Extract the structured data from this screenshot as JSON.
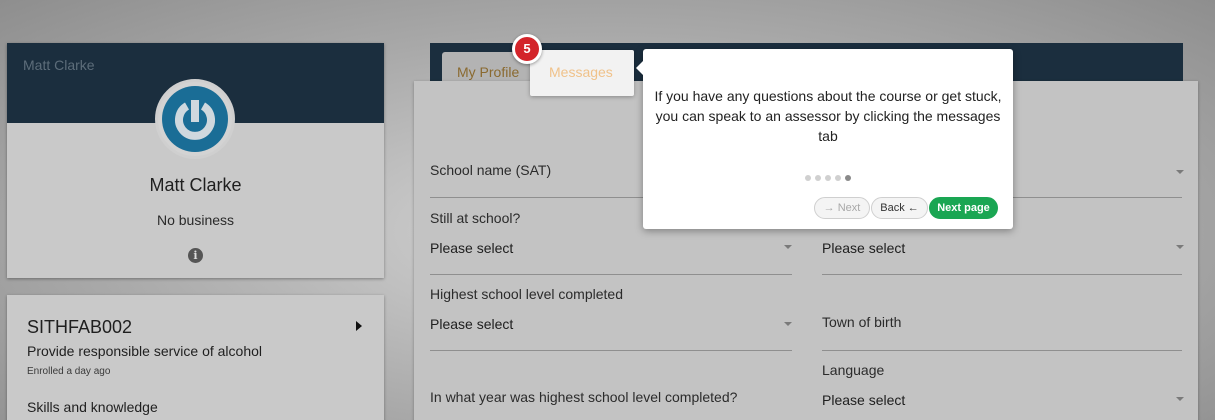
{
  "profile": {
    "header_name": "Matt Clarke",
    "name": "Matt Clarke",
    "business": "No business",
    "info_icon": "i"
  },
  "course": {
    "code": "SITHFAB002",
    "title": "Provide responsible service of alcohol",
    "enrolled": "Enrolled a day ago",
    "section": "Skills and knowledge"
  },
  "tabs": {
    "my_profile": "My Profile",
    "messages": "Messages"
  },
  "tour": {
    "step": "5",
    "text": "If you have any questions about the course or get stuck, you can speak to an assessor by clicking the messages tab",
    "total_steps": 5,
    "current_step": 5,
    "next_label": "→ Next",
    "back_label": "Back ←",
    "next_page_label": "Next page"
  },
  "form": {
    "school_name_label": "School name (SAT)",
    "still_at_school_label": "Still at school?",
    "still_at_school_value": "Please select",
    "right_select_value": "Please select",
    "highest_level_label": "Highest school level completed",
    "highest_level_value": "Please select",
    "town_of_birth_label": "Town of birth",
    "language_label": "Language",
    "language_value": "Please select",
    "year_completed_label": "In what year was highest school level completed?"
  },
  "colors": {
    "header_bg": "#1b2e3e",
    "accent_green": "#1aa653",
    "badge_red": "#d3242a",
    "avatar_blue": "#1a6d96"
  }
}
